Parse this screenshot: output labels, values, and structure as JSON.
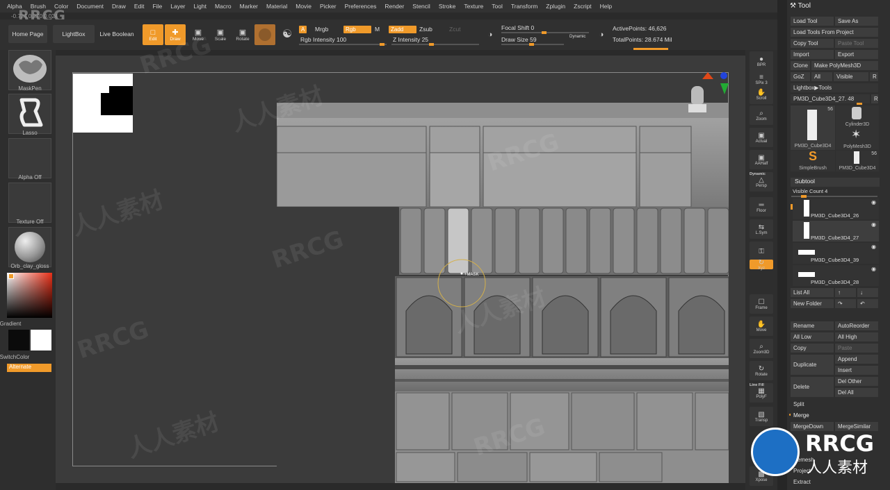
{
  "menu": [
    "Alpha",
    "Brush",
    "Color",
    "Document",
    "Draw",
    "Edit",
    "File",
    "Layer",
    "Light",
    "Macro",
    "Marker",
    "Material",
    "Movie",
    "Picker",
    "Preferences",
    "Render",
    "Stencil",
    "Stroke",
    "Texture",
    "Tool",
    "Transform",
    "Zplugin",
    "Zscript",
    "Help"
  ],
  "logo": "RRCG",
  "coords": "-0.724,0.270,0.024",
  "toolbar": {
    "home": "Home Page",
    "lightbox": "LightBox",
    "live_boolean": "Live Boolean",
    "edit": "Edit",
    "draw": "Draw",
    "move": "Move",
    "scale": "Scale",
    "rotate": "Rotate",
    "a": "A",
    "mrgb": "Mrgb",
    "rgb": "Rgb",
    "m": "M",
    "zadd": "Zadd",
    "zsub": "Zsub",
    "zcut": "Zcut",
    "rgb_intensity": "Rgb Intensity 100",
    "z_intensity": "Z Intensity 25",
    "focal_shift": "Focal Shift 0",
    "draw_size": "Draw Size 59",
    "dynamic": "Dynamic",
    "active_points": "ActivePoints: 46,626",
    "total_points": "TotalPoints: 28.674 Mil"
  },
  "left": {
    "maskpen": "MaskPen",
    "lasso": "Lasso",
    "alpha": "Alpha Off",
    "texture": "Texture Off",
    "material": "Orb_clay_gloss",
    "gradient": "Gradient",
    "switchcolor": "SwitchColor",
    "alternate": "Alternate"
  },
  "right_shelf": [
    {
      "label": "BPR",
      "icon": "render-icon"
    },
    {
      "label": "SPix 3",
      "icon": "spix-icon"
    },
    {
      "label": "Scroll",
      "icon": "hand-icon"
    },
    {
      "label": "Zoom",
      "icon": "zoom-icon"
    },
    {
      "label": "Actual",
      "icon": "actual-icon"
    },
    {
      "label": "AAHalf",
      "icon": "aahalf-icon"
    },
    {
      "label": "Persp",
      "icon": "persp-icon"
    },
    {
      "label": "Floor",
      "icon": "floor-icon"
    },
    {
      "label": "L.Sym",
      "icon": "lsym-icon"
    },
    {
      "label": "",
      "icon": "lock-icon"
    },
    {
      "label": "Xyz",
      "icon": "xyz-icon"
    },
    {
      "label": "Frame",
      "icon": "frame-icon"
    },
    {
      "label": "Move",
      "icon": "move-icon"
    },
    {
      "label": "Zoom3D",
      "icon": "zoom3d-icon"
    },
    {
      "label": "Rotate",
      "icon": "rotate-icon"
    },
    {
      "label": "PolyF",
      "icon": "polyf-icon"
    },
    {
      "label": "Transp",
      "icon": "transp-icon"
    },
    {
      "label": "Xpose",
      "icon": "xpose-icon"
    }
  ],
  "dynamic_label": "Dynamic",
  "line_fill": "Line Fill",
  "tool": {
    "title": "Tool",
    "load_tool": "Load Tool",
    "save_as": "Save As",
    "load_from_project": "Load Tools From Project",
    "copy_tool": "Copy Tool",
    "paste_tool": "Paste Tool",
    "import": "Import",
    "export": "Export",
    "clone": "Clone",
    "make_polymesh": "Make PolyMesh3D",
    "goz": "GoZ",
    "all": "All",
    "visible": "Visible",
    "r": "R",
    "lightbox_tools": "Lightbox▶Tools",
    "current_tool": "PM3D_Cube3D4_27. 48",
    "thumbs": [
      {
        "name": "PM3D_Cube3D4",
        "count": "56"
      },
      {
        "name": "Cylinder3D",
        "count": ""
      },
      {
        "name": "PolyMesh3D",
        "count": ""
      },
      {
        "name": "SimpleBrush",
        "count": ""
      },
      {
        "name": "PM3D_Cube3D4",
        "count": "56"
      }
    ],
    "subtool": "Subtool",
    "visible_count": "Visible Count 4",
    "subtools": [
      "PM3D_Cube3D4_26",
      "PM3D_Cube3D4_27",
      "PM3D_Cube3D4_39",
      "PM3D_Cube3D4_28"
    ],
    "list_all": "List All",
    "new_folder": "New Folder",
    "rename": "Rename",
    "autoreorder": "AutoReorder",
    "all_low": "All Low",
    "all_high": "All High",
    "copy": "Copy",
    "paste": "Paste",
    "duplicate": "Duplicate",
    "append": "Append",
    "insert": "Insert",
    "delete": "Delete",
    "del_other": "Del Other",
    "del_all": "Del All",
    "split": "Split",
    "merge": "Merge",
    "merge_down": "MergeDown",
    "merge_similar": "MergeSimilar",
    "remesh": "Remesh",
    "project": "Project",
    "extract": "Extract"
  },
  "cursor_label": "+MASK",
  "watermarks": [
    "RRCG",
    "人人素材"
  ],
  "colors": {
    "accent": "#f09a2a",
    "panel": "#2f2f2f",
    "canvas": "#3b3b3b"
  }
}
